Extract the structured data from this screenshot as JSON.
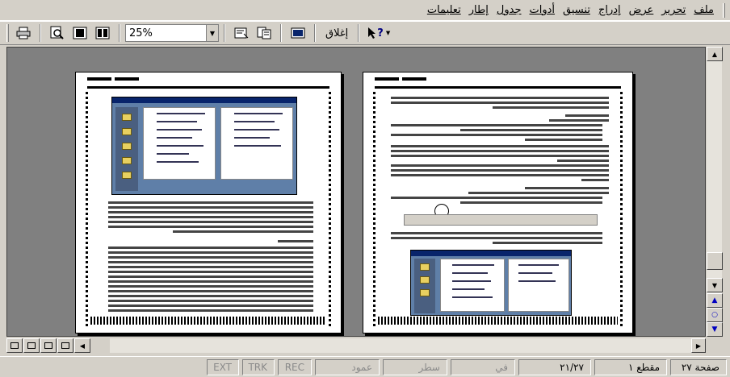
{
  "menubar": {
    "items": [
      "ملف",
      "تحرير",
      "عرض",
      "إدراج",
      "تنسيق",
      "أدوات",
      "جدول",
      "إطار",
      "تعليمات"
    ]
  },
  "toolbar": {
    "zoom_value": "25%",
    "close_label": "إغلاق",
    "help_label": "?"
  },
  "statusbar": {
    "page": "صفحة ٢٧",
    "section": "مقطع ١",
    "page_count": "٢١/٢٧",
    "at": "في",
    "line": "سطر",
    "column": "عمود",
    "rec": "REC",
    "trk": "TRK",
    "ext": "EXT"
  }
}
